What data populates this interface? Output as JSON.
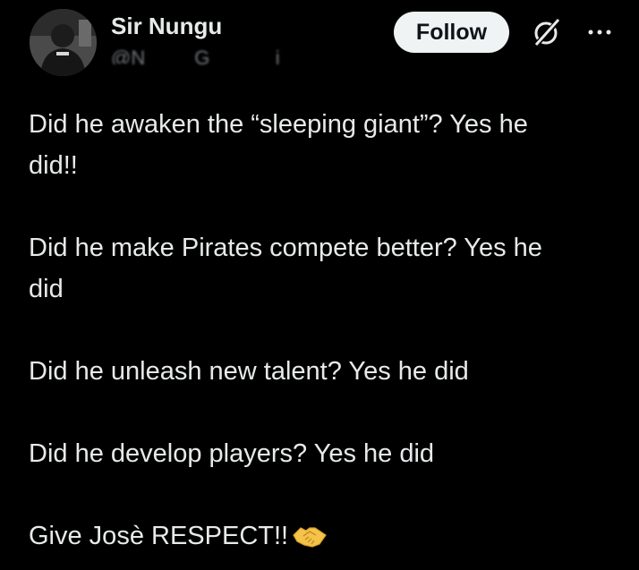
{
  "author": {
    "name": "Sir Nungu",
    "handle": "@N____ G______i"
  },
  "actions": {
    "follow_label": "Follow"
  },
  "icons": {
    "grok": "grok-icon",
    "more": "more-icon",
    "handshake": "handshake-emoji"
  },
  "tweet": {
    "line1": "Did he awaken the “sleeping giant”? Yes he",
    "line2": "did!!",
    "line3": "Did he make Pirates compete better? Yes he",
    "line4": "did",
    "line5": "Did he unleash new talent? Yes he did",
    "line6": "Did he develop players? Yes he did",
    "line7": "Give Josè RESPECT!!"
  },
  "colors": {
    "background": "#000000",
    "text_primary": "#e7e9ea",
    "text_secondary": "#71767b",
    "follow_bg": "#eff3f4",
    "follow_text": "#0f1419"
  }
}
